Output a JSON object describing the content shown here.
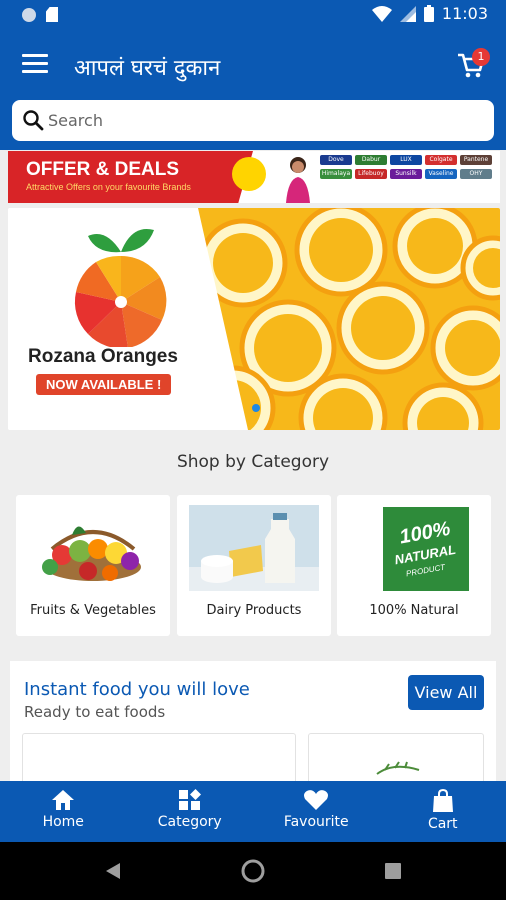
{
  "status_bar": {
    "time": "11:03"
  },
  "app_bar": {
    "title": "आपलं घरचं दुकान",
    "cart_count": "1"
  },
  "search": {
    "placeholder": "Search"
  },
  "offer_banner": {
    "title": "OFFER & DEALS",
    "subtitle": "Attractive Offers on your favourite Brands",
    "brands": [
      "Dove",
      "Dabur",
      "LUX",
      "Colgate",
      "Pantene",
      "Himalaya",
      "Lifebuoy",
      "Sunsilk",
      "Vaseline",
      "OHY"
    ]
  },
  "hero": {
    "brand": "Rozana Oranges",
    "badge": "NOW AVAILABLE !"
  },
  "shop_by_category": {
    "heading": "Shop by Category",
    "items": [
      {
        "label": "Fruits & Vegetables"
      },
      {
        "label": "Dairy Products"
      },
      {
        "label": "100% Natural",
        "badge_line1": "100%",
        "badge_line2": "NATURAL",
        "badge_line3": "PRODUCT"
      }
    ]
  },
  "instant_food": {
    "title": "Instant food you will love",
    "subtitle": "Ready to eat foods",
    "view_all": "View All"
  },
  "bottom_nav": {
    "items": [
      {
        "label": "Home",
        "icon": "home-icon"
      },
      {
        "label": "Category",
        "icon": "category-icon"
      },
      {
        "label": "Favourite",
        "icon": "heart-icon"
      },
      {
        "label": "Cart",
        "icon": "bag-icon"
      }
    ]
  },
  "colors": {
    "primary": "#0b59b3",
    "offer_red": "#d82427",
    "orange": "#f7b81a"
  }
}
